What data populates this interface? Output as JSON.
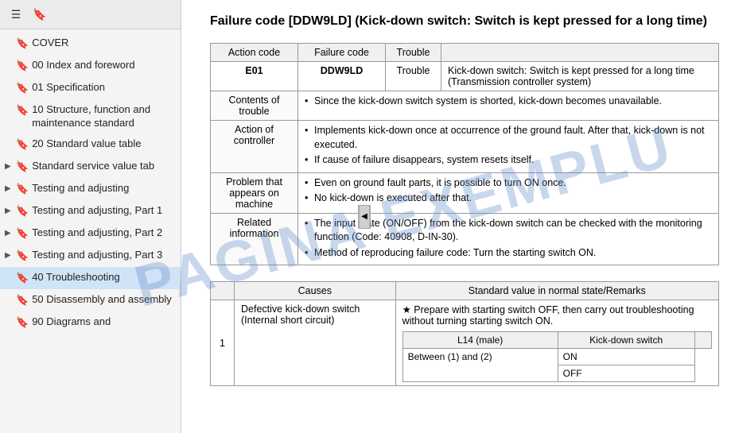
{
  "sidebar": {
    "toolbar": {
      "menu_icon": "☰",
      "bookmark_icon": "🔖"
    },
    "items": [
      {
        "label": "COVER",
        "has_arrow": false,
        "active": false
      },
      {
        "label": "00 Index and foreword",
        "has_arrow": false,
        "active": false
      },
      {
        "label": "01 Specification",
        "has_arrow": false,
        "active": false
      },
      {
        "label": "10 Structure, function and maintenance standard",
        "has_arrow": false,
        "active": false
      },
      {
        "label": "20 Standard value table",
        "has_arrow": false,
        "active": false
      },
      {
        "label": "Standard service value tab",
        "has_arrow": true,
        "active": false
      },
      {
        "label": "Testing and adjusting",
        "has_arrow": true,
        "active": false
      },
      {
        "label": "Testing and adjusting, Part 1",
        "has_arrow": true,
        "active": false
      },
      {
        "label": "Testing and adjusting, Part 2",
        "has_arrow": true,
        "active": false
      },
      {
        "label": "Testing and adjusting, Part 3",
        "has_arrow": true,
        "active": false
      },
      {
        "label": "40 Troubleshooting",
        "has_arrow": false,
        "active": true
      },
      {
        "label": "50 Disassembly and assembly",
        "has_arrow": false,
        "active": false
      },
      {
        "label": "90 Diagrams and",
        "has_arrow": false,
        "active": false
      }
    ],
    "collapse_arrow": "◀"
  },
  "main": {
    "title": "Failure code [DDW9LD] (Kick-down switch: Switch is kept pressed for a long time)",
    "info_table": {
      "col_headers": [
        "Action code",
        "Failure code",
        "Trouble"
      ],
      "action_code": "E01",
      "failure_code": "DDW9LD",
      "trouble_label": "Trouble",
      "trouble_desc": "Kick-down switch: Switch is kept pressed for a long time (Transmission controller system)",
      "rows": [
        {
          "label": "Contents of trouble",
          "bullets": [
            "Since the kick-down switch system is shorted, kick-down becomes unavailable."
          ]
        },
        {
          "label": "Action of controller",
          "bullets": [
            "Implements kick-down once at occurrence of the ground fault. After that, kick-down is not executed.",
            "If cause of failure disappears, system resets itself."
          ]
        },
        {
          "label": "Problem that appears on machine",
          "bullets": [
            "Even on ground fault parts, it is possible to turn ON once.",
            "No kick-down is executed after that."
          ]
        },
        {
          "label": "Related information",
          "bullets": [
            "The input state (ON/OFF) from the kick-down switch can be checked with the monitoring function (Code: 40908, D-IN-30).",
            "Method of reproducing failure code: Turn the starting switch ON."
          ]
        }
      ]
    },
    "causes_table": {
      "headers": [
        "Causes",
        "Standard value in normal state/Remarks"
      ],
      "rows": [
        {
          "number": "1",
          "cause": "Defective kick-down switch (Internal short circuit)",
          "sub_rows": [
            {
              "prepare_note": "★ Prepare with starting switch OFF, then carry out troubleshooting without turning starting switch ON.",
              "connector": "L14 (male)",
              "signal": "Kick-down switch",
              "condition": "Between (1) and (2)",
              "values": [
                "ON",
                "OFF"
              ]
            }
          ]
        }
      ]
    },
    "watermark": "PAGINA EXEMPLU"
  }
}
